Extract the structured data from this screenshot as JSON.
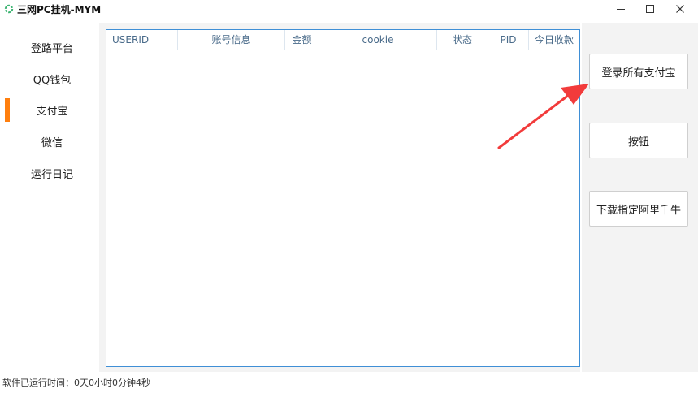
{
  "window": {
    "title": "三网PC挂机-MYM",
    "minimize_glyph": "—",
    "maximize_glyph": "☐",
    "close_glyph": "✕"
  },
  "nav": {
    "items": [
      {
        "label": "登路平台"
      },
      {
        "label": "QQ钱包"
      },
      {
        "label": "支付宝"
      },
      {
        "label": "微信"
      },
      {
        "label": "运行日记"
      }
    ],
    "selected": "支付宝",
    "indicator_color": "#ff7f0e"
  },
  "table": {
    "columns": [
      "USERID",
      "账号信息",
      "金额",
      "cookie",
      "状态",
      "PID",
      "今日收款"
    ],
    "rows": []
  },
  "actions": {
    "login_all_alipay": "登录所有支付宝",
    "button": "按钮",
    "download_ali_qianniu": "下载指定阿里千牛"
  },
  "status": {
    "runtime": "软件已运行时间：0天0小时0分钟4秒"
  },
  "annotation": {
    "arrow_color": "#f23b3b"
  }
}
